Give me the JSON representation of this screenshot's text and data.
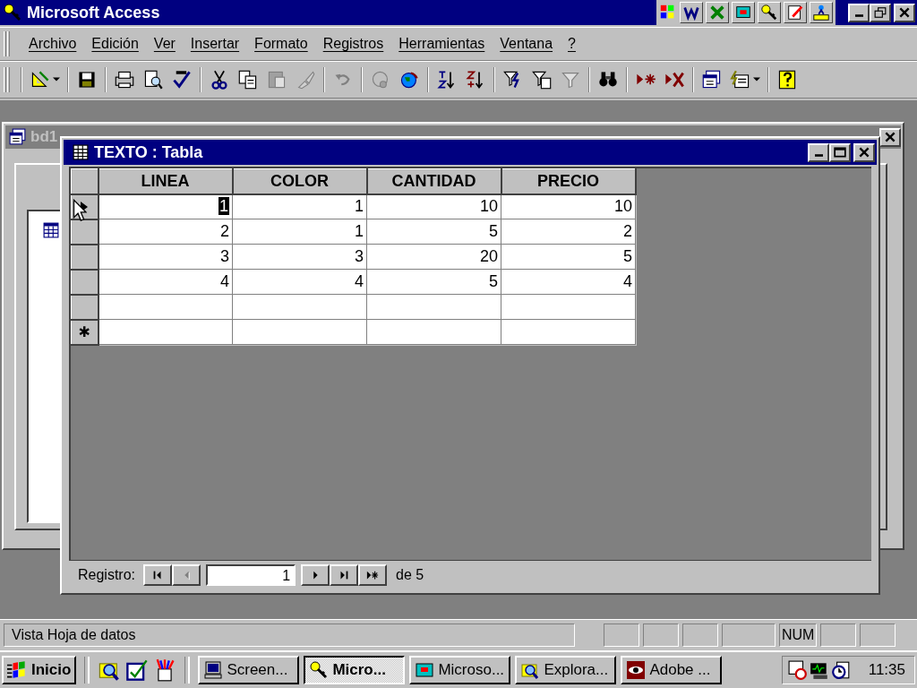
{
  "window": {
    "title": "Microsoft Access"
  },
  "menu": [
    "Archivo",
    "Edición",
    "Ver",
    "Insertar",
    "Formato",
    "Registros",
    "Herramientas",
    "Ventana",
    "?"
  ],
  "database_window": {
    "title": "bd1"
  },
  "table_window": {
    "title": "TEXTO : Tabla",
    "columns": [
      "LINEA",
      "COLOR",
      "CANTIDAD",
      "PRECIO"
    ],
    "rows": [
      {
        "kind": "record",
        "current": true,
        "cells": [
          {
            "text": "1",
            "selected": true
          },
          {
            "text": "1",
            "selected": false
          },
          {
            "text": "10",
            "selected": false
          },
          {
            "text": "10",
            "selected": false
          }
        ]
      },
      {
        "kind": "record",
        "current": false,
        "cells": [
          {
            "text": "2",
            "selected": false
          },
          {
            "text": "1",
            "selected": false
          },
          {
            "text": "5",
            "selected": false
          },
          {
            "text": "2",
            "selected": false
          }
        ]
      },
      {
        "kind": "record",
        "current": false,
        "cells": [
          {
            "text": "3",
            "selected": false
          },
          {
            "text": "3",
            "selected": false
          },
          {
            "text": "20",
            "selected": false
          },
          {
            "text": "5",
            "selected": false
          }
        ]
      },
      {
        "kind": "record",
        "current": false,
        "cells": [
          {
            "text": "4",
            "selected": false
          },
          {
            "text": "4",
            "selected": false
          },
          {
            "text": "5",
            "selected": false
          },
          {
            "text": "4",
            "selected": false
          }
        ]
      },
      {
        "kind": "blank",
        "current": false
      },
      {
        "kind": "new",
        "current": false,
        "marker": "✱"
      }
    ],
    "navigation": {
      "label": "Registro:",
      "value": "1",
      "total": "de 5",
      "buttons": [
        {
          "kind": "first",
          "disabled": false
        },
        {
          "kind": "prev",
          "disabled": true
        },
        {
          "kind": "next",
          "disabled": false
        },
        {
          "kind": "last",
          "disabled": false
        },
        {
          "kind": "new",
          "disabled": false
        }
      ]
    }
  },
  "status_bar": {
    "text": "Vista Hoja de datos",
    "indicators": [
      {
        "kind": "empty"
      },
      {
        "kind": "empty"
      },
      {
        "kind": "empty"
      },
      {
        "kind": "empty"
      },
      {
        "kind": "text",
        "label": "NUM"
      },
      {
        "kind": "empty"
      },
      {
        "kind": "empty"
      }
    ]
  },
  "taskbar": {
    "start": "Inicio",
    "tasks": [
      {
        "label": "Screen...",
        "selected": false
      },
      {
        "label": "Micro...",
        "selected": true
      },
      {
        "label": "Microso...",
        "selected": false
      },
      {
        "label": "Explora...",
        "selected": false
      },
      {
        "label": "Adobe ...",
        "selected": false
      }
    ],
    "clock": "11:35"
  }
}
